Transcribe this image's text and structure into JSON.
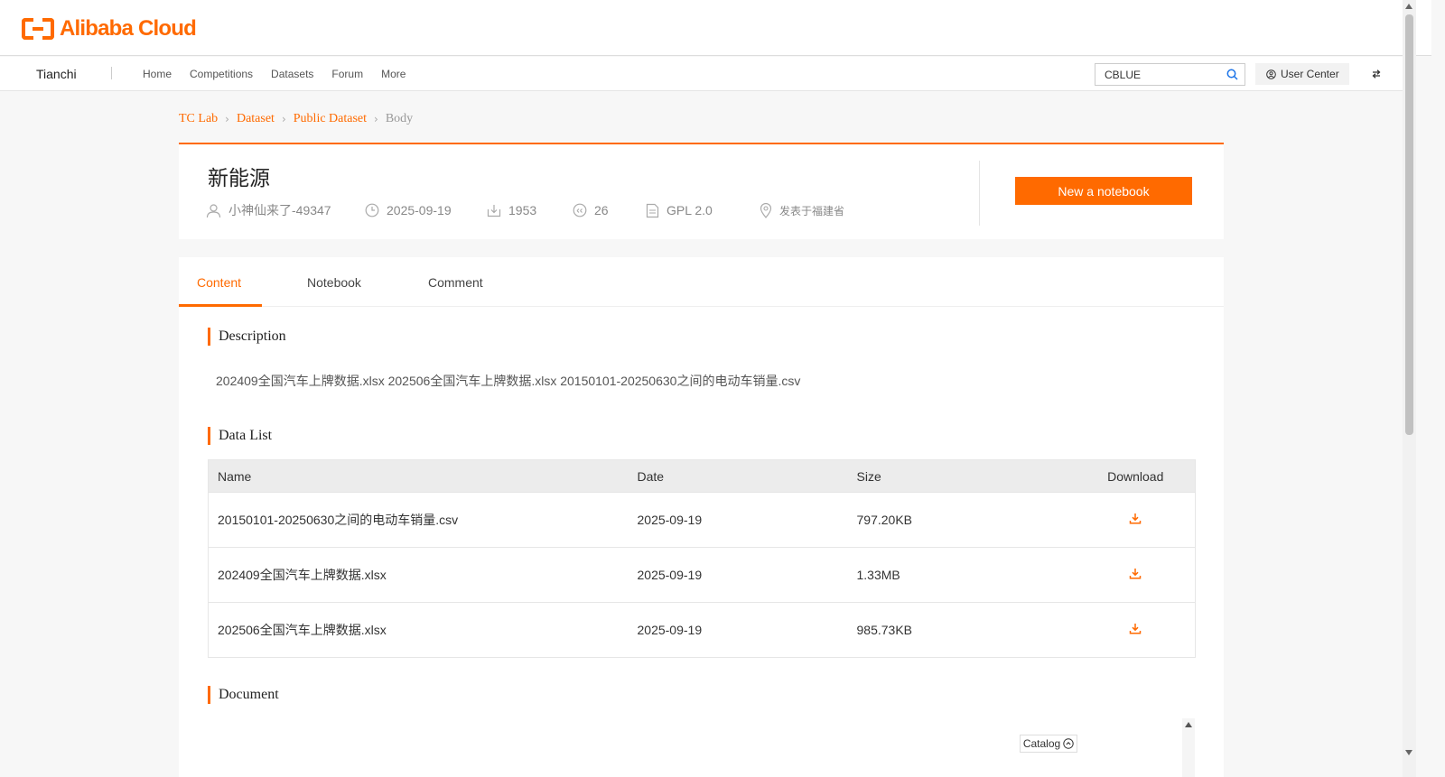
{
  "logo": {
    "text": "Alibaba Cloud"
  },
  "nav": {
    "brand": "Tianchi",
    "links": [
      "Home",
      "Competitions",
      "Datasets",
      "Forum",
      "More"
    ],
    "search_value": "CBLUE",
    "user_center": "User Center"
  },
  "breadcrumb": [
    "TC Lab",
    "Dataset",
    "Public Dataset",
    "Body"
  ],
  "dataset": {
    "title": "新能源",
    "author": "小神仙来了-49347",
    "date": "2025-09-19",
    "downloads": "1953",
    "citations": "26",
    "license": "GPL 2.0",
    "location": "发表于福建省",
    "new_notebook_label": "New a notebook"
  },
  "tabs": [
    "Content",
    "Notebook",
    "Comment"
  ],
  "sections": {
    "description_title": "Description",
    "description_text": "202409全国汽车上牌数据.xlsx 202506全国汽车上牌数据.xlsx 20150101-20250630之间的电动车销量.csv",
    "datalist_title": "Data List",
    "document_title": "Document"
  },
  "table": {
    "headers": [
      "Name",
      "Date",
      "Size",
      "Download"
    ],
    "rows": [
      {
        "name": "20150101-20250630之间的电动车销量.csv",
        "date": "2025-09-19",
        "size": "797.20KB"
      },
      {
        "name": "202409全国汽车上牌数据.xlsx",
        "date": "2025-09-19",
        "size": "1.33MB"
      },
      {
        "name": "202506全国汽车上牌数据.xlsx",
        "date": "2025-09-19",
        "size": "985.73KB"
      }
    ]
  },
  "catalog_label": "Catalog",
  "colors": {
    "accent": "#ff6a00"
  },
  "icons": {
    "search": "search-icon",
    "user": "user-icon",
    "clock": "clock-icon",
    "download": "download-icon",
    "cite": "cite-icon",
    "license": "document-icon",
    "location": "location-icon"
  }
}
